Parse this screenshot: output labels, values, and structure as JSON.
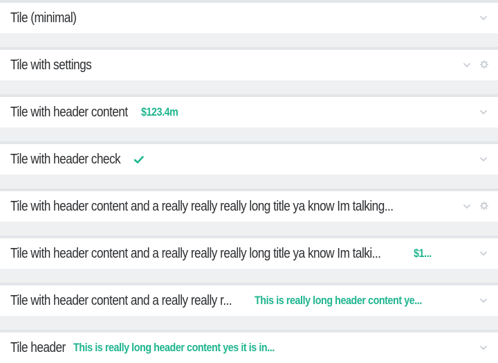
{
  "tiles": [
    {
      "title": "Tile (minimal)",
      "content": "",
      "settings": false,
      "check": false
    },
    {
      "title": "Tile with settings",
      "content": "",
      "settings": true,
      "check": false
    },
    {
      "title": "Tile with header content",
      "content": "$123.4m",
      "settings": false,
      "check": false
    },
    {
      "title": "Tile with header check",
      "content": "",
      "settings": false,
      "check": true
    },
    {
      "title": "Tile with header content and a really really really long title ya know Im talking...",
      "content": "",
      "settings": true,
      "check": false
    },
    {
      "title": "Tile with header content and a really really really long title ya know Im talki...",
      "content": "$1...",
      "settings": false,
      "check": false
    },
    {
      "title": "Tile with header content and a really really r...",
      "content": "This is really long header content ye...",
      "settings": false,
      "check": false
    },
    {
      "title": "Tile header",
      "content": "This is really long header content yes it is in...",
      "settings": false,
      "check": false
    }
  ],
  "icons": {
    "collapse": "chevron-down-icon",
    "settings": "gear-icon",
    "check": "check-icon"
  },
  "colors": {
    "accent": "#1fb58f",
    "title": "#2b2d30",
    "icon": "#c9ced3",
    "background": "#eef0f2",
    "tile": "#ffffff"
  }
}
